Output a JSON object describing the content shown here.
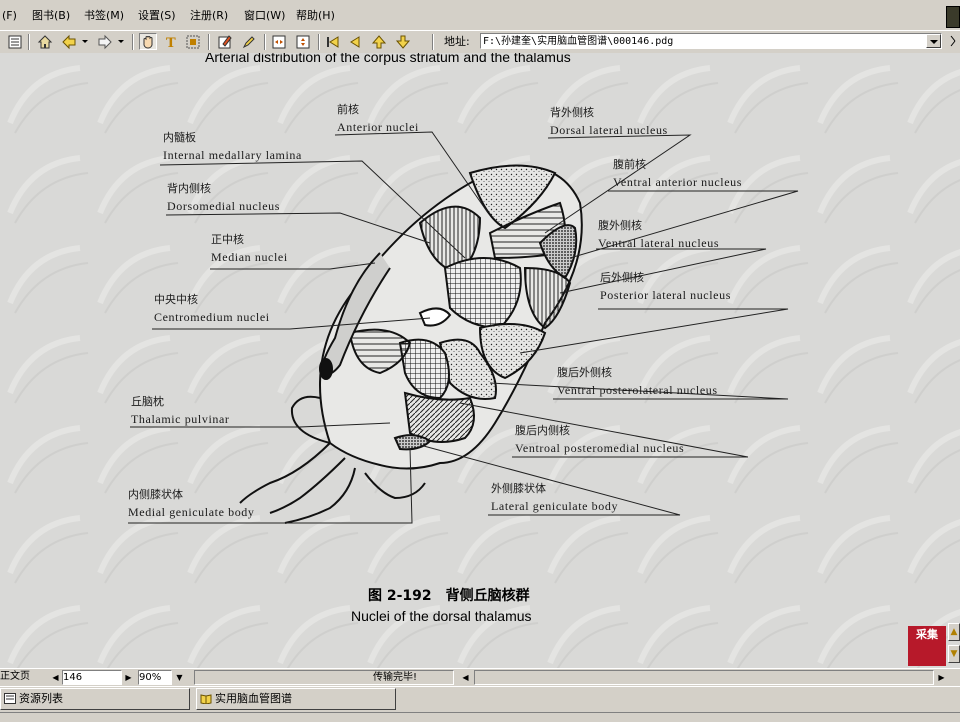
{
  "menu": {
    "items": [
      "(F)",
      "图书(B)",
      "书签(M)",
      "设置(S)",
      "注册(R)",
      "窗口(W)",
      "帮助(H)"
    ]
  },
  "toolbar": {
    "address_label": "地址:",
    "address_value": "F:\\孙建奎\\实用脑血管图谱\\000146.pdg"
  },
  "figure": {
    "top_caption_cut": "Arterial distribution of the corpus striatum and the thalamus",
    "caption_cn": "图 2-192　背侧丘脑核群",
    "caption_en": "Nuclei of the dorsal thalamus",
    "labels": [
      {
        "cn": "前核",
        "en": "Anterior nuclei"
      },
      {
        "cn": "背外侧核",
        "en": "Dorsal lateral nucleus"
      },
      {
        "cn": "内髓板",
        "en": "Internal medallary lamina"
      },
      {
        "cn": "背内侧核",
        "en": "Dorsomedial   nucleus"
      },
      {
        "cn": "腹前核",
        "en": "Ventral anterior nucleus"
      },
      {
        "cn": "正中核",
        "en": "Median nuclei"
      },
      {
        "cn": "腹外侧核",
        "en": "Ventral lateral nucleus"
      },
      {
        "cn": "后外侧核",
        "en": "Posterior lateral nucleus"
      },
      {
        "cn": "中央中核",
        "en": "Centromedium nuclei"
      },
      {
        "cn": "腹后外侧核",
        "en": "Ventral posterolateral nucleus"
      },
      {
        "cn": "丘脑枕",
        "en": "Thalamic pulvinar"
      },
      {
        "cn": "腹后内侧核",
        "en": "Ventroal posteromedial nucleus"
      },
      {
        "cn": "外侧膝状体",
        "en": "Lateral geniculate body"
      },
      {
        "cn": "内侧膝状体",
        "en": "Medial geniculate body"
      }
    ]
  },
  "side": {
    "stamp": "采集"
  },
  "status": {
    "page_mode": "正文页",
    "page_number": "146",
    "zoom": "90%",
    "message": "传输完毕!"
  },
  "taskbar": {
    "items": [
      "资源列表",
      "实用脑血管图谱"
    ]
  }
}
